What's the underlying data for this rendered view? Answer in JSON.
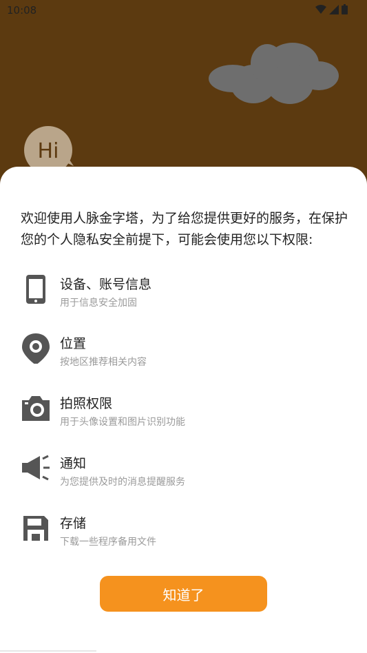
{
  "status_bar": {
    "time": "10:08",
    "icons": [
      "wifi-icon",
      "signal-icon",
      "battery-icon"
    ]
  },
  "hero": {
    "greeting": "Hi"
  },
  "dialog": {
    "intro": "欢迎使用人脉金字塔，为了给您提供更好的服务，在保护您的个人隐私安全前提下，可能会使用您以下权限:",
    "permissions": [
      {
        "icon": "phone-icon",
        "title": "设备、账号信息",
        "desc": "用于信息安全加固"
      },
      {
        "icon": "location-pin-icon",
        "title": "位置",
        "desc": "按地区推荐相关内容"
      },
      {
        "icon": "camera-icon",
        "title": "拍照权限",
        "desc": "用于头像设置和图片识别功能"
      },
      {
        "icon": "speaker-icon",
        "title": "通知",
        "desc": "为您提供及时的消息提醒服务"
      },
      {
        "icon": "save-icon",
        "title": "存储",
        "desc": "下载一些程序备用文件"
      }
    ],
    "confirm_label": "知道了"
  },
  "colors": {
    "background": "#5c3a10",
    "accent": "#f5921e",
    "icon": "#555555",
    "text": "#222222",
    "subtext": "#9a9a9a"
  }
}
